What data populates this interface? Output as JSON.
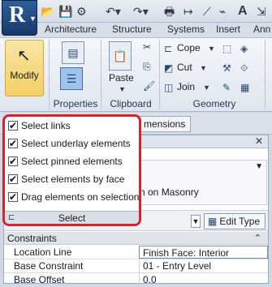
{
  "app": {
    "button_glyph": "R"
  },
  "quick_access": {
    "icons": [
      "open-icon",
      "save-icon",
      "settings-icon",
      "undo-icon",
      "redo-icon",
      "print-icon",
      "measure-icon",
      "text-icon",
      "more-icon"
    ],
    "text_tool": "A"
  },
  "ribbon_tabs": [
    "Architecture",
    "Structure",
    "Systems",
    "Insert",
    "Ann"
  ],
  "ribbon": {
    "modify": {
      "label": "Modify"
    },
    "properties_group": {
      "title": "Properties"
    },
    "clipboard_group": {
      "title": "Clipboard",
      "paste_label": "Paste"
    },
    "geometry_group": {
      "title": "Geometry",
      "cope_label": "Cope",
      "cut_label": "Cut",
      "join_label": "Join"
    }
  },
  "strip": {
    "tab_label": "mensions"
  },
  "select_menu": {
    "items": [
      {
        "label": "Select links",
        "checked": true
      },
      {
        "label": "Select underlay elements",
        "checked": true
      },
      {
        "label": "Select pinned elements",
        "checked": true
      },
      {
        "label": "Select elements by face",
        "checked": true
      },
      {
        "label": "Drag elements on selection",
        "checked": true
      }
    ],
    "footer": "Select"
  },
  "properties": {
    "type_text": "n on Masonry",
    "edit_type_label": "Edit Type",
    "section_label": "Constraints",
    "rows": [
      {
        "key": "Location Line",
        "value": "Finish Face: Interior"
      },
      {
        "key": "Base Constraint",
        "value": "01 - Entry Level"
      },
      {
        "key": "Base Offset",
        "value": "0.0"
      }
    ]
  },
  "colors": {
    "highlight": "#d8232a",
    "app_button": "#1f4a82",
    "modify_active": "#f4cf64"
  }
}
